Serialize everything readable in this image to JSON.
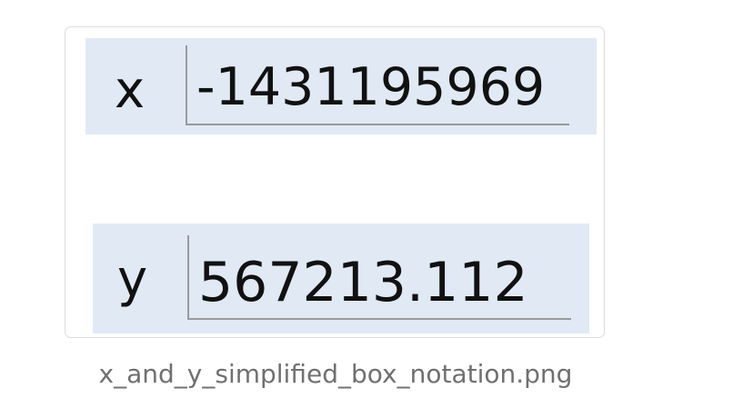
{
  "image": {
    "variables": [
      {
        "name": "x",
        "value": "-1431195969"
      },
      {
        "name": "y",
        "value": "567213.112"
      }
    ],
    "caption": "x_and_y_simplified_box_notation.png"
  },
  "colors": {
    "box_fill": "#e1e9f5",
    "field_border": "#9a9a9a",
    "text": "#111111",
    "caption": "#707070",
    "card_border": "#dcdcdc"
  }
}
